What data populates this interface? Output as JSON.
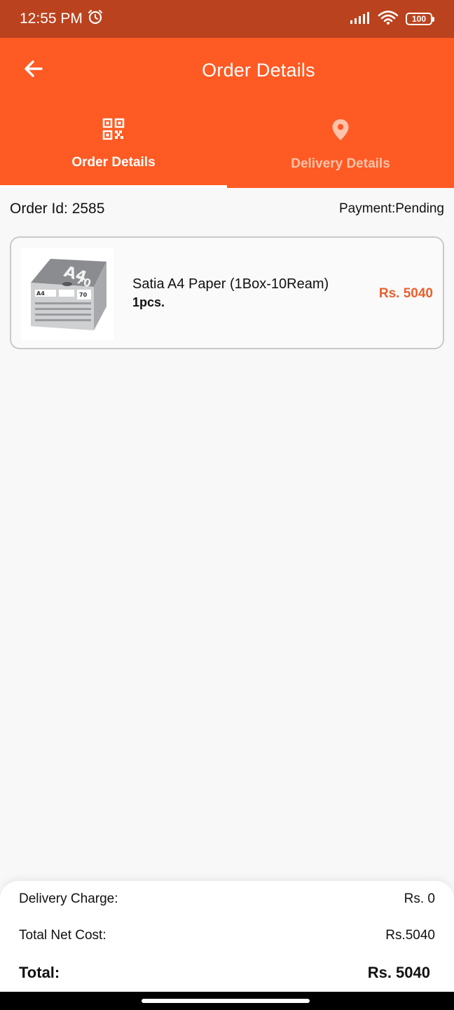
{
  "status_bar": {
    "time": "12:55 PM",
    "battery": "100",
    "icons": [
      "alarm-icon",
      "signal-icon",
      "wifi-icon",
      "battery-icon"
    ]
  },
  "app_bar": {
    "title": "Order Details",
    "back_icon": "arrow-left-icon",
    "color": "#fe5a23"
  },
  "tabs": [
    {
      "label": "Order Details",
      "icon": "qr-code-icon",
      "selected": true
    },
    {
      "label": "Delivery Details",
      "icon": "location-pin-icon",
      "selected": false
    }
  ],
  "order": {
    "id_label": "Order Id: 2585",
    "payment_label": "Payment:Pending"
  },
  "items": [
    {
      "name": "Satia A4 Paper (1Box-10Ream)",
      "qty": "1pcs.",
      "price": "Rs. 5040",
      "image": "product-image",
      "image_text": "A4 70"
    }
  ],
  "summary": {
    "delivery_label": "Delivery Charge:",
    "delivery_value": "Rs. 0",
    "net_label": "Total Net Cost:",
    "net_value": "Rs.5040",
    "total_label": "Total:",
    "total_value": "Rs. 5040"
  },
  "colors": {
    "accent": "#fe5a23",
    "status_bar": "#bb421e",
    "price": "#e9602e"
  }
}
